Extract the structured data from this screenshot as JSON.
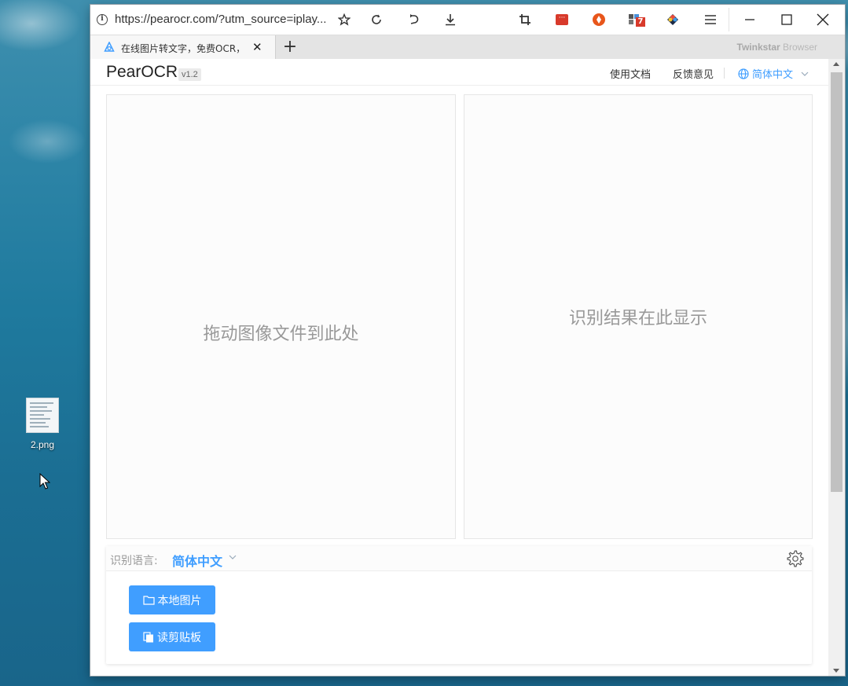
{
  "desktop": {
    "icon_label": "2.png"
  },
  "browser": {
    "url": "https://pearocr.com/?utm_source=iplay...",
    "tab_title": "在线图片转文字，免费OCR，",
    "brand_name": "Twinkstar",
    "brand_suffix": " Browser",
    "toolbar_icons": [
      "info-icon",
      "star-icon",
      "reload-icon",
      "undo-icon",
      "download-icon",
      "crop-icon",
      "ext-red-icon",
      "ext-orange-icon",
      "ext-apps-icon",
      "ext-globe-icon",
      "menu-icon"
    ],
    "badge_count": "7"
  },
  "app": {
    "logo": "PearOCR",
    "version": "v1.2",
    "nav": {
      "docs": "使用文档",
      "feedback": "反馈意见",
      "language": "简体中文"
    },
    "drop_zone_text": "拖动图像文件到此处",
    "result_text": "识别结果在此显示",
    "recognition": {
      "label": "识别语言:",
      "value": "简体中文"
    },
    "buttons": {
      "local_image": "本地图片",
      "read_clipboard": "读剪贴板"
    },
    "accent_color": "#409eff"
  }
}
